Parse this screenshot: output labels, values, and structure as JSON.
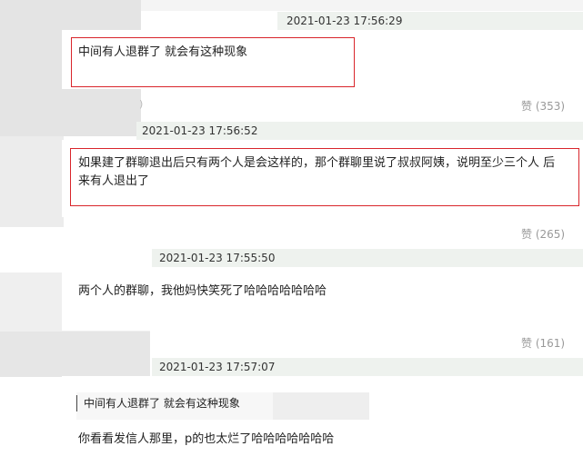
{
  "comments": [
    {
      "timestamp": "2021-01-23 17:56:29",
      "text": "中间有人退群了 就会有这种现象",
      "likes": "赞 (353)",
      "stray_char": ")"
    },
    {
      "timestamp": "2021-01-23 17:56:52",
      "text": "如果建了群聊退出后只有两个人是会这样的，那个群聊里说了叔叔阿姨，说明至少三个人 后\n来有人退出了",
      "likes": "赞 (265)"
    },
    {
      "timestamp": "2021-01-23 17:55:50",
      "text": "两个人的群聊，我他妈快笑死了哈哈哈哈哈哈哈",
      "likes": "赞 (161)"
    },
    {
      "timestamp": "2021-01-23 17:57:07",
      "quote": "中间有人退群了 就会有这种现象",
      "text": "你看看发信人那里，p的也太烂了哈哈哈哈哈哈哈"
    }
  ]
}
